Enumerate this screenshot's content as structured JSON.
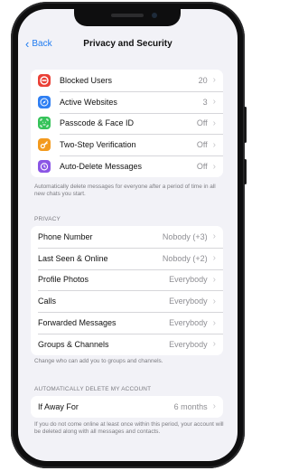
{
  "nav": {
    "back_label": "Back",
    "title": "Privacy and Security"
  },
  "security": {
    "items": [
      {
        "label": "Blocked Users",
        "value": "20",
        "icon": "block-icon",
        "color": "#ea4036"
      },
      {
        "label": "Active Websites",
        "value": "3",
        "icon": "compass-icon",
        "color": "#2f7ff3"
      },
      {
        "label": "Passcode & Face ID",
        "value": "Off",
        "icon": "faceid-icon",
        "color": "#36c35a"
      },
      {
        "label": "Two-Step Verification",
        "value": "Off",
        "icon": "key-icon",
        "color": "#f39a1e"
      },
      {
        "label": "Auto-Delete Messages",
        "value": "Off",
        "icon": "timer-icon",
        "color": "#8b56e5"
      }
    ],
    "footnote": "Automatically delete messages for everyone after a period of time in all new chats you start."
  },
  "privacy": {
    "header": "PRIVACY",
    "items": [
      {
        "label": "Phone Number",
        "value": "Nobody (+3)"
      },
      {
        "label": "Last Seen & Online",
        "value": "Nobody (+2)"
      },
      {
        "label": "Profile Photos",
        "value": "Everybody"
      },
      {
        "label": "Calls",
        "value": "Everybody"
      },
      {
        "label": "Forwarded Messages",
        "value": "Everybody"
      },
      {
        "label": "Groups & Channels",
        "value": "Everybody"
      }
    ],
    "footnote": "Change who can add you to groups and channels."
  },
  "account": {
    "header": "AUTOMATICALLY DELETE MY ACCOUNT",
    "items": [
      {
        "label": "If Away For",
        "value": "6 months"
      }
    ],
    "footnote": "If you do not come online at least once within this period, your account will be deleted along with all messages and contacts."
  }
}
